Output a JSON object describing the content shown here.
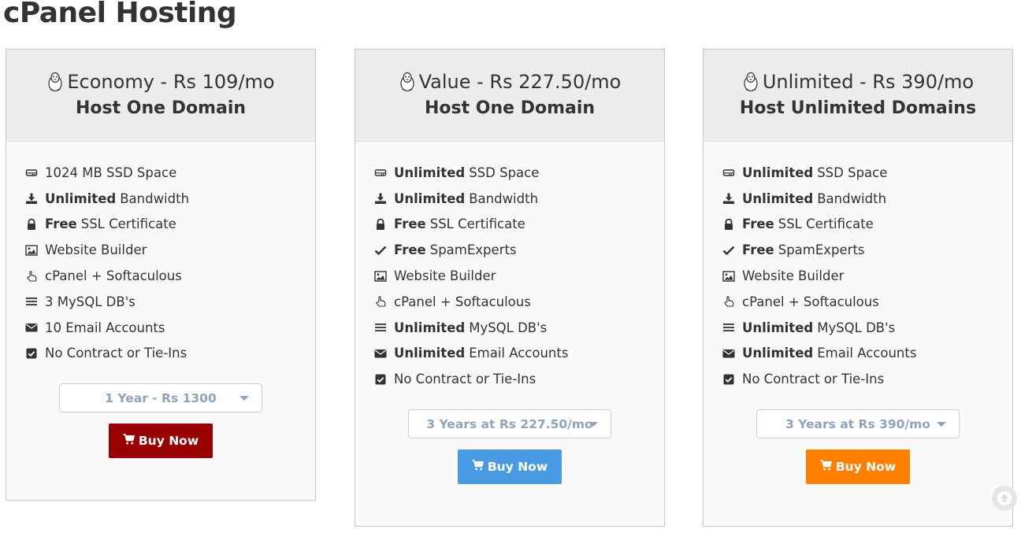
{
  "page": {
    "title": "cPanel Hosting"
  },
  "plans": [
    {
      "name": "Economy - Rs 109/mo",
      "tagline": "Host One Domain",
      "features": [
        {
          "icon": "hdd-icon",
          "bold": "",
          "text": "1024 MB SSD Space"
        },
        {
          "icon": "download-icon",
          "bold": "Unlimited",
          "text": "Bandwidth"
        },
        {
          "icon": "lock-icon",
          "bold": "Free",
          "text": "SSL Certificate"
        },
        {
          "icon": "image-icon",
          "bold": "",
          "text": "Website Builder"
        },
        {
          "icon": "hand-pointer-icon",
          "bold": "",
          "text": "cPanel + Softaculous"
        },
        {
          "icon": "list-icon",
          "bold": "",
          "text": "3 MySQL DB's"
        },
        {
          "icon": "envelope-icon",
          "bold": "",
          "text": "10 Email Accounts"
        },
        {
          "icon": "check-square-icon",
          "bold": "",
          "text": "No Contract or Tie-Ins"
        }
      ],
      "billing_selected": "1 Year - Rs 1300",
      "buy_label": "Buy Now",
      "buy_color": "#990000"
    },
    {
      "name": "Value - Rs 227.50/mo",
      "tagline": "Host One Domain",
      "features": [
        {
          "icon": "hdd-icon",
          "bold": "Unlimited",
          "text": "SSD Space"
        },
        {
          "icon": "download-icon",
          "bold": "Unlimited",
          "text": "Bandwidth"
        },
        {
          "icon": "lock-icon",
          "bold": "Free",
          "text": "SSL Certificate"
        },
        {
          "icon": "check-icon",
          "bold": "Free",
          "text": "SpamExperts"
        },
        {
          "icon": "image-icon",
          "bold": "",
          "text": "Website Builder"
        },
        {
          "icon": "hand-pointer-icon",
          "bold": "",
          "text": "cPanel + Softaculous"
        },
        {
          "icon": "list-icon",
          "bold": "Unlimited",
          "text": "MySQL DB's"
        },
        {
          "icon": "envelope-icon",
          "bold": "Unlimited",
          "text": "Email Accounts"
        },
        {
          "icon": "check-square-icon",
          "bold": "",
          "text": "No Contract or Tie-Ins"
        }
      ],
      "billing_selected": "3 Years at Rs 227.50/mo",
      "buy_label": "Buy Now",
      "buy_color": "#4a9ae3"
    },
    {
      "name": "Unlimited - Rs 390/mo",
      "tagline": "Host Unlimited Domains",
      "features": [
        {
          "icon": "hdd-icon",
          "bold": "Unlimited",
          "text": "SSD Space"
        },
        {
          "icon": "download-icon",
          "bold": "Unlimited",
          "text": "Bandwidth"
        },
        {
          "icon": "lock-icon",
          "bold": "Free",
          "text": "SSL Certificate"
        },
        {
          "icon": "check-icon",
          "bold": "Free",
          "text": "SpamExperts"
        },
        {
          "icon": "image-icon",
          "bold": "",
          "text": "Website Builder"
        },
        {
          "icon": "hand-pointer-icon",
          "bold": "",
          "text": "cPanel + Softaculous"
        },
        {
          "icon": "list-icon",
          "bold": "Unlimited",
          "text": "MySQL DB's"
        },
        {
          "icon": "envelope-icon",
          "bold": "Unlimited",
          "text": "Email Accounts"
        },
        {
          "icon": "check-square-icon",
          "bold": "",
          "text": "No Contract or Tie-Ins"
        }
      ],
      "billing_selected": "3 Years at Rs 390/mo",
      "buy_label": "Buy Now",
      "buy_color": "#ff8000"
    }
  ],
  "icons": {
    "plan": "tux-icon",
    "buy": "shopping-cart-icon",
    "scroll": "arrow-up-circle-icon"
  }
}
